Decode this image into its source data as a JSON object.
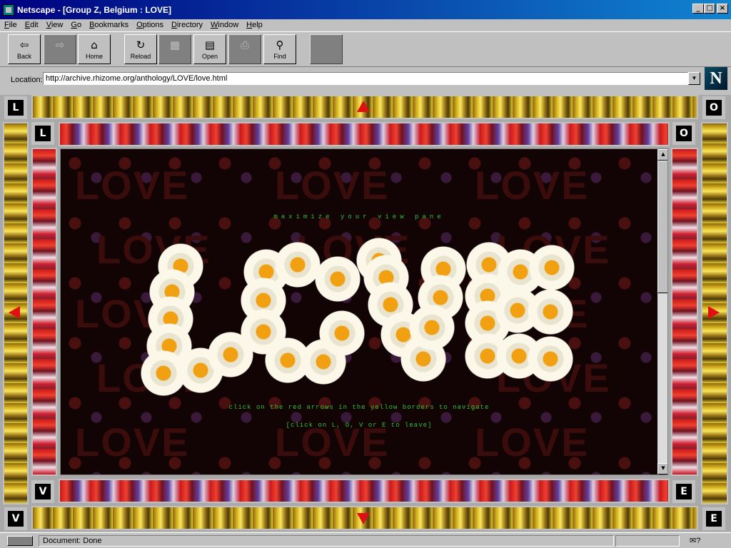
{
  "window": {
    "title": "Netscape - [Group Z, Belgium : LOVE]",
    "minimize": "_",
    "maximize": "□",
    "close": "×"
  },
  "menu": [
    "File",
    "Edit",
    "View",
    "Go",
    "Bookmarks",
    "Options",
    "Directory",
    "Window",
    "Help"
  ],
  "toolbar": {
    "back": "Back",
    "forward": "",
    "home": "Home",
    "reload": "Reload",
    "images": "",
    "open": "Open",
    "print": "",
    "find": "Find",
    "stop": ""
  },
  "location": {
    "label": "Location:",
    "url": "http://archive.rhizome.org/anthology/LOVE/love.html"
  },
  "logo": "N",
  "frame": {
    "letters": [
      "L",
      "O",
      "V",
      "E"
    ],
    "main_title_word": "LOVE",
    "maximize_text": "maximize your view pane",
    "navigate_text": "click on the red arrows in the yellow borders to navigate",
    "leave_text": "[click on L, O, V or E to leave]"
  },
  "status": {
    "text": "Document: Done",
    "right": "✉?"
  },
  "colors": {
    "titlebar": "#000080",
    "accent_text": "#30c030",
    "arrow": "#e01010"
  }
}
